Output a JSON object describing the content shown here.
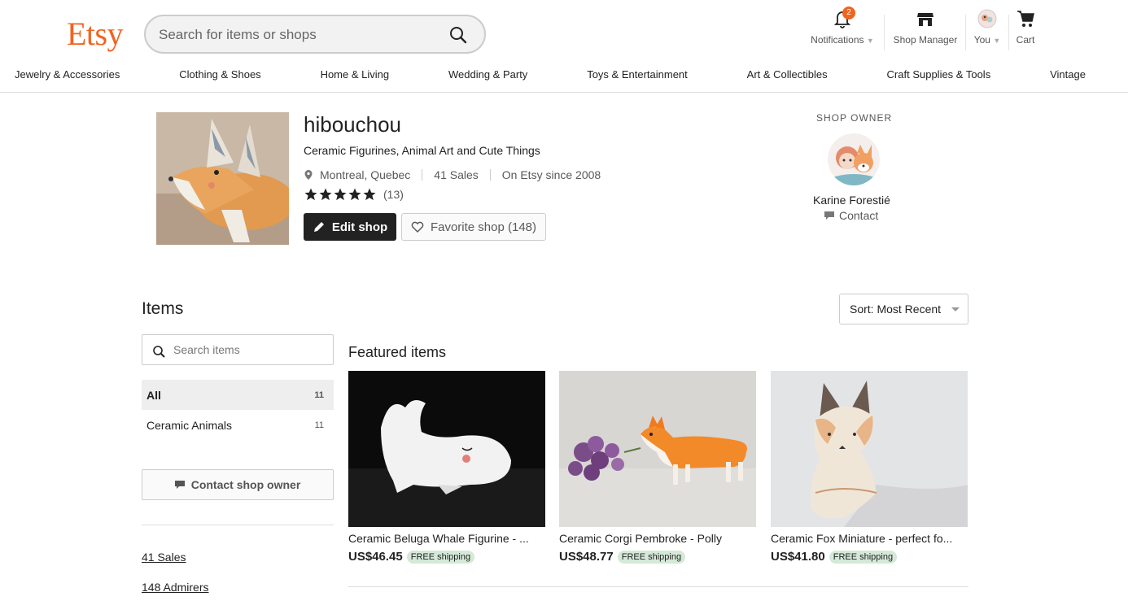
{
  "header": {
    "logo": "Etsy",
    "search_placeholder": "Search for items or shops",
    "nav": {
      "notifications": "Notifications",
      "notifications_badge": "2",
      "shop_manager": "Shop Manager",
      "you": "You",
      "cart": "Cart"
    }
  },
  "categories": [
    "Jewelry & Accessories",
    "Clothing & Shoes",
    "Home & Living",
    "Wedding & Party",
    "Toys & Entertainment",
    "Art & Collectibles",
    "Craft Supplies & Tools",
    "Vintage"
  ],
  "shop": {
    "name": "hibouchou",
    "title": "Ceramic Figurines, Animal Art and Cute Things",
    "location": "Montreal, Quebec",
    "sales": "41 Sales",
    "since": "On Etsy since 2008",
    "rating": 5,
    "reviews": "(13)",
    "edit_label": "Edit shop",
    "favorite_label": "Favorite shop (148)"
  },
  "owner": {
    "heading": "SHOP OWNER",
    "name": "Karine Forestié",
    "contact": "Contact"
  },
  "items": {
    "heading": "Items",
    "sort_label": "Sort: Most Recent",
    "search_placeholder": "Search items",
    "sections": [
      {
        "label": "All",
        "count": "11"
      },
      {
        "label": "Ceramic Animals",
        "count": "11"
      }
    ],
    "contact_owner": "Contact shop owner",
    "links": [
      "41 Sales",
      "148 Admirers"
    ],
    "featured_heading": "Featured items",
    "featured": [
      {
        "title": "Ceramic Beluga Whale Figurine - ...",
        "price": "US$46.45",
        "shipping": "FREE shipping"
      },
      {
        "title": "Ceramic Corgi Pembroke - Polly",
        "price": "US$48.77",
        "shipping": "FREE shipping"
      },
      {
        "title": "Ceramic Fox Miniature - perfect fo...",
        "price": "US$41.80",
        "shipping": "FREE shipping"
      }
    ]
  },
  "colors": {
    "brand": "#F1641E",
    "shipping_badge": "#d4e9d7",
    "dark_button": "#222222"
  }
}
